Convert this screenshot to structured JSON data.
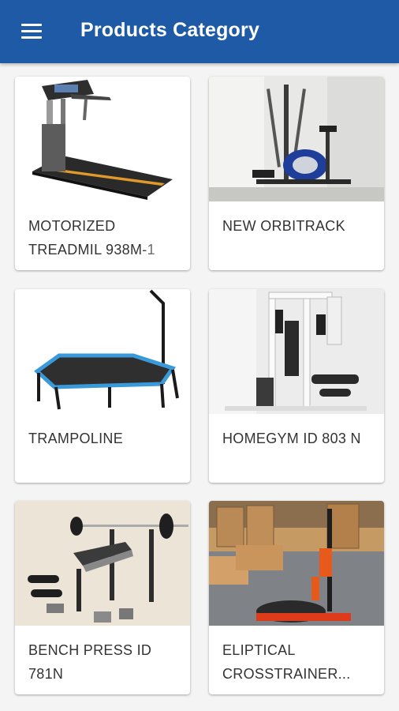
{
  "header": {
    "title": "Products Category",
    "menu_icon": "hamburger-menu-icon",
    "color": "#1f5aa6"
  },
  "products": [
    {
      "name": "MOTORIZED TREADMIL 938M-1",
      "icon": "treadmill-image"
    },
    {
      "name": "NEW ORBITRACK",
      "icon": "orbitrack-image"
    },
    {
      "name": "TRAMPOLINE",
      "icon": "trampoline-image"
    },
    {
      "name": "HOMEGYM ID 803 N",
      "icon": "homegym-image"
    },
    {
      "name": "BENCH PRESS ID 781N",
      "icon": "bench-press-image"
    },
    {
      "name": "ELIPTICAL CROSSTRAINER...",
      "icon": "elliptical-crosstrainer-image"
    }
  ]
}
